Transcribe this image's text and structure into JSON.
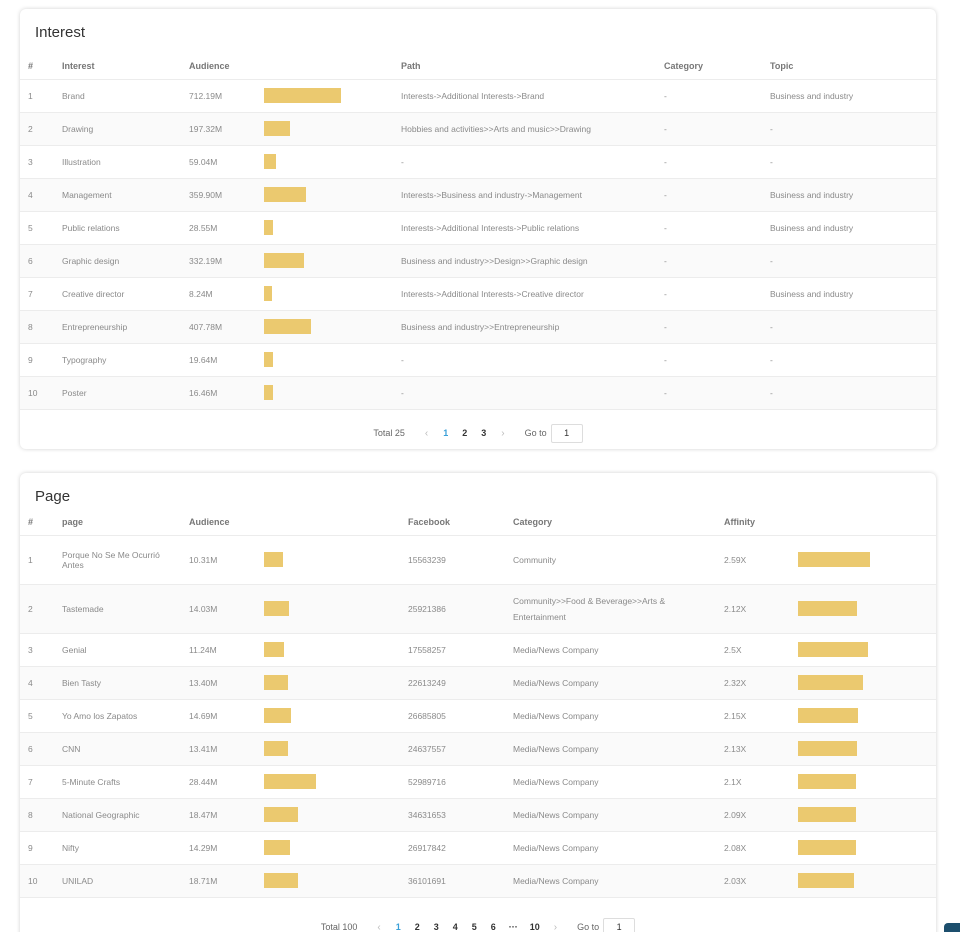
{
  "interest": {
    "title": "Interest",
    "headers": {
      "idx": "#",
      "interest": "Interest",
      "audience": "Audience",
      "path": "Path",
      "category": "Category",
      "topic": "Topic"
    },
    "rows": [
      {
        "idx": "1",
        "interest": "Brand",
        "audience": "712.19M",
        "bar_fraction": 1.0,
        "path": "Interests->Additional Interests->Brand",
        "category": "-",
        "topic": "Business and industry"
      },
      {
        "idx": "2",
        "interest": "Drawing",
        "audience": "197.32M",
        "bar_fraction": 0.34,
        "path": "Hobbies and activities>>Arts and music>>Drawing",
        "category": "-",
        "topic": "-"
      },
      {
        "idx": "3",
        "interest": "Illustration",
        "audience": "59.04M",
        "bar_fraction": 0.16,
        "path": "-",
        "category": "-",
        "topic": "-"
      },
      {
        "idx": "4",
        "interest": "Management",
        "audience": "359.90M",
        "bar_fraction": 0.55,
        "path": "Interests->Business and industry->Management",
        "category": "-",
        "topic": "Business and industry"
      },
      {
        "idx": "5",
        "interest": "Public relations",
        "audience": "28.55M",
        "bar_fraction": 0.12,
        "path": "Interests->Additional Interests->Public relations",
        "category": "-",
        "topic": "Business and industry"
      },
      {
        "idx": "6",
        "interest": "Graphic design",
        "audience": "332.19M",
        "bar_fraction": 0.52,
        "path": "Business and industry>>Design>>Graphic design",
        "category": "-",
        "topic": "-"
      },
      {
        "idx": "7",
        "interest": "Creative director",
        "audience": "8.24M",
        "bar_fraction": 0.1,
        "path": "Interests->Additional Interests->Creative director",
        "category": "-",
        "topic": "Business and industry"
      },
      {
        "idx": "8",
        "interest": "Entrepreneurship",
        "audience": "407.78M",
        "bar_fraction": 0.61,
        "path": "Business and industry>>Entrepreneurship",
        "category": "-",
        "topic": "-"
      },
      {
        "idx": "9",
        "interest": "Typography",
        "audience": "19.64M",
        "bar_fraction": 0.12,
        "path": "-",
        "category": "-",
        "topic": "-"
      },
      {
        "idx": "10",
        "interest": "Poster",
        "audience": "16.46M",
        "bar_fraction": 0.12,
        "path": "-",
        "category": "-",
        "topic": "-"
      }
    ],
    "pager": {
      "total": "Total 25",
      "prev": "‹",
      "pages": [
        "1",
        "2",
        "3"
      ],
      "active": "1",
      "next": "›",
      "goto": "Go to",
      "goto_value": "1"
    }
  },
  "page": {
    "title": "Page",
    "headers": {
      "idx": "#",
      "page": "page",
      "audience": "Audience",
      "facebook": "Facebook",
      "category": "Category",
      "affinity": "Affinity"
    },
    "rows": [
      {
        "idx": "1",
        "page": "Porque No Se Me Ocurrió Antes",
        "audience": "10.31M",
        "bar_fraction": 0.36,
        "facebook": "15563239",
        "category": "Community",
        "affinity": "2.59X",
        "affinity_fraction": 1.0,
        "tall": true
      },
      {
        "idx": "2",
        "page": "Tastemade",
        "audience": "14.03M",
        "bar_fraction": 0.49,
        "facebook": "25921386",
        "category": "Community>>Food & Beverage>>Arts & Entertainment",
        "affinity": "2.12X",
        "affinity_fraction": 0.82,
        "tall": true
      },
      {
        "idx": "3",
        "page": "Genial",
        "audience": "11.24M",
        "bar_fraction": 0.39,
        "facebook": "17558257",
        "category": "Media/News Company",
        "affinity": "2.5X",
        "affinity_fraction": 0.97,
        "tall": false
      },
      {
        "idx": "4",
        "page": "Bien Tasty",
        "audience": "13.40M",
        "bar_fraction": 0.47,
        "facebook": "22613249",
        "category": "Media/News Company",
        "affinity": "2.32X",
        "affinity_fraction": 0.9,
        "tall": false
      },
      {
        "idx": "5",
        "page": "Yo Amo los Zapatos",
        "audience": "14.69M",
        "bar_fraction": 0.52,
        "facebook": "26685805",
        "category": "Media/News Company",
        "affinity": "2.15X",
        "affinity_fraction": 0.83,
        "tall": false
      },
      {
        "idx": "6",
        "page": "CNN",
        "audience": "13.41M",
        "bar_fraction": 0.47,
        "facebook": "24637557",
        "category": "Media/News Company",
        "affinity": "2.13X",
        "affinity_fraction": 0.82,
        "tall": false
      },
      {
        "idx": "7",
        "page": "5-Minute Crafts",
        "audience": "28.44M",
        "bar_fraction": 1.0,
        "facebook": "52989716",
        "category": "Media/News Company",
        "affinity": "2.1X",
        "affinity_fraction": 0.81,
        "tall": false
      },
      {
        "idx": "8",
        "page": "National Geographic",
        "audience": "18.47M",
        "bar_fraction": 0.65,
        "facebook": "34631653",
        "category": "Media/News Company",
        "affinity": "2.09X",
        "affinity_fraction": 0.81,
        "tall": false
      },
      {
        "idx": "9",
        "page": "Nifty",
        "audience": "14.29M",
        "bar_fraction": 0.5,
        "facebook": "26917842",
        "category": "Media/News Company",
        "affinity": "2.08X",
        "affinity_fraction": 0.8,
        "tall": false
      },
      {
        "idx": "10",
        "page": "UNILAD",
        "audience": "18.71M",
        "bar_fraction": 0.66,
        "facebook": "36101691",
        "category": "Media/News Company",
        "affinity": "2.03X",
        "affinity_fraction": 0.78,
        "tall": false
      }
    ],
    "pager": {
      "total": "Total 100",
      "prev": "‹",
      "pages": [
        "1",
        "2",
        "3",
        "4",
        "5",
        "6",
        "···",
        "10"
      ],
      "active": "1",
      "next": "›",
      "goto": "Go to",
      "goto_value": "1"
    }
  },
  "colors": {
    "bar": "#ebc96f",
    "active_page": "#3aa0d8"
  }
}
